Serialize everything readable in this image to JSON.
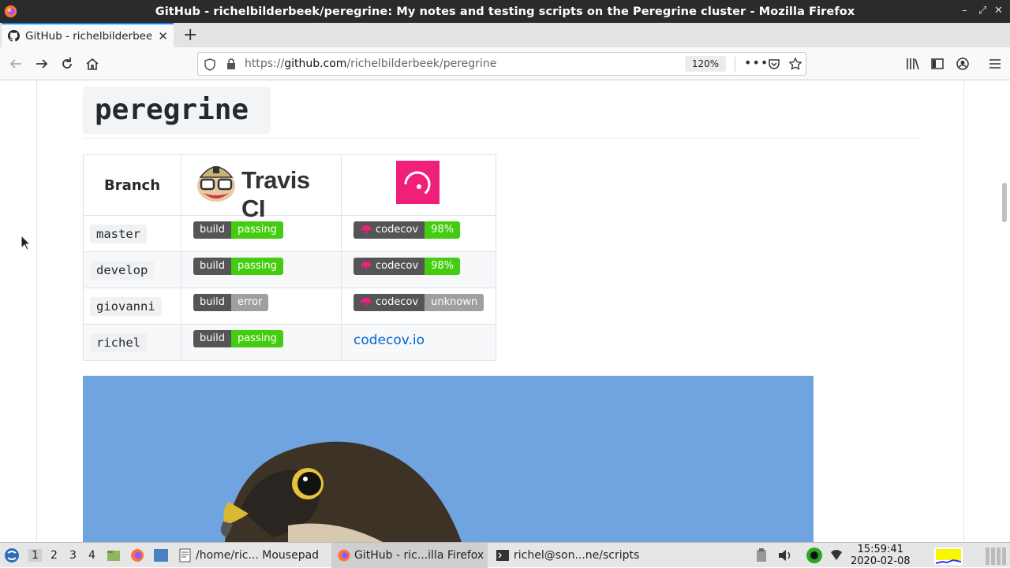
{
  "window": {
    "title": "GitHub - richelbilderbeek/peregrine: My notes and testing scripts on the Peregrine cluster - Mozilla Firefox"
  },
  "tab": {
    "label": "GitHub - richelbilderbeek/peregrine"
  },
  "navbar": {
    "url_prefix": "https://",
    "url_host": "github.com",
    "url_path": "/richelbilderbeek/peregrine",
    "zoom": "120%"
  },
  "readme": {
    "heading": "peregrine",
    "table": {
      "col_branch": "Branch",
      "travis_logo_text": "Travis CI",
      "rows": [
        {
          "branch": "master",
          "build_label": "build",
          "build_status": "passing",
          "build_color": "#44cc11",
          "cov_label": "codecov",
          "cov_value": "98%",
          "cov_color": "#44cc11"
        },
        {
          "branch": "develop",
          "build_label": "build",
          "build_status": "passing",
          "build_color": "#44cc11",
          "cov_label": "codecov",
          "cov_value": "98%",
          "cov_color": "#44cc11"
        },
        {
          "branch": "giovanni",
          "build_label": "build",
          "build_status": "error",
          "build_color": "#9f9f9f",
          "cov_label": "codecov",
          "cov_value": "unknown",
          "cov_color": "#9f9f9f"
        },
        {
          "branch": "richel",
          "build_label": "build",
          "build_status": "passing",
          "build_color": "#44cc11",
          "cov_link": "codecov.io"
        }
      ]
    }
  },
  "taskbar": {
    "workspaces": [
      "1",
      "2",
      "3",
      "4"
    ],
    "apps": [
      {
        "label": "/home/ric... Mousepad"
      },
      {
        "label": "GitHub - ric...illa Firefox"
      },
      {
        "label": "richel@son...ne/scripts"
      }
    ],
    "time": "15:59:41",
    "date": "2020-02-08"
  },
  "colors": {
    "accent": "#0a84ff",
    "link": "#0366d6",
    "codecov_brand": "#f01f7a"
  }
}
